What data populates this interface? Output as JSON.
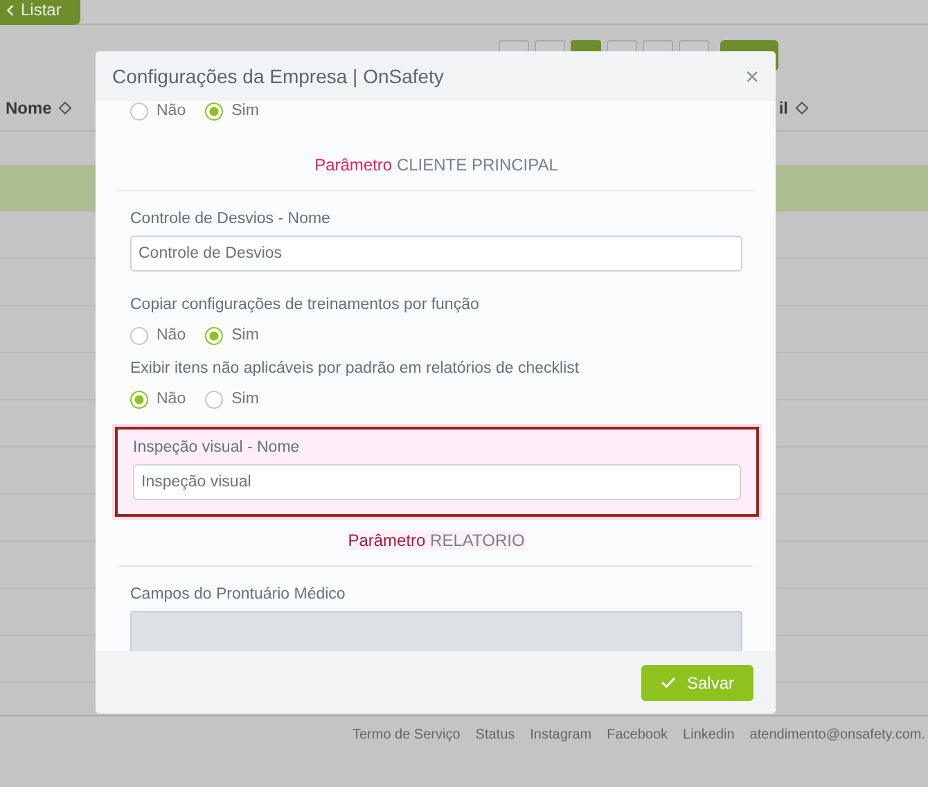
{
  "page": {
    "back_button": "Listar",
    "pagination": [
      {
        "selected": false
      },
      {
        "selected": false
      },
      {
        "selected": true
      },
      {
        "selected": false
      },
      {
        "selected": false
      },
      {
        "selected": false
      }
    ],
    "table": {
      "columns": [
        "Nome",
        "il"
      ],
      "rows": [
        {
          "selected": true
        },
        {
          "selected": false
        },
        {
          "selected": false
        },
        {
          "selected": false
        },
        {
          "selected": false
        },
        {
          "selected": false
        },
        {
          "selected": false
        },
        {
          "selected": false
        },
        {
          "selected": false
        },
        {
          "selected": false
        },
        {
          "selected": false
        }
      ]
    },
    "footer_links": [
      "Termo de Serviço",
      "Status",
      "Instagram",
      "Facebook",
      "Linkedin",
      "atendimento@onsafety.com."
    ]
  },
  "modal": {
    "title": "Configurações da Empresa | OnSafety",
    "close": "×",
    "items": [
      {
        "kind": "radio_group",
        "options": [
          {
            "label": "Não",
            "selected": false
          },
          {
            "label": "Sim",
            "selected": true
          }
        ]
      },
      {
        "kind": "section_heading",
        "prefix": "Parâmetro",
        "title": "CLIENTE PRINCIPAL",
        "highlighted": false
      },
      {
        "kind": "text_field",
        "label": "Controle de Desvios - Nome",
        "value": "Controle de Desvios",
        "highlighted": false
      },
      {
        "kind": "radio_group",
        "label": "Copiar configurações de treinamentos por função",
        "options": [
          {
            "label": "Não",
            "selected": false
          },
          {
            "label": "Sim",
            "selected": true
          }
        ]
      },
      {
        "kind": "radio_group",
        "label": "Exibir itens não aplicáveis por padrão em relatórios de checklist",
        "options": [
          {
            "label": "Não",
            "selected": true
          },
          {
            "label": "Sim",
            "selected": false
          }
        ]
      },
      {
        "kind": "text_field",
        "label": "Inspeção visual - Nome",
        "value": "Inspeção visual",
        "highlighted": true
      },
      {
        "kind": "section_heading",
        "prefix": "Parâmetro",
        "title": "RELATORIO",
        "highlighted": true
      },
      {
        "kind": "grid",
        "label": "Campos do Prontuário Médico"
      }
    ],
    "save_button": "Salvar"
  }
}
